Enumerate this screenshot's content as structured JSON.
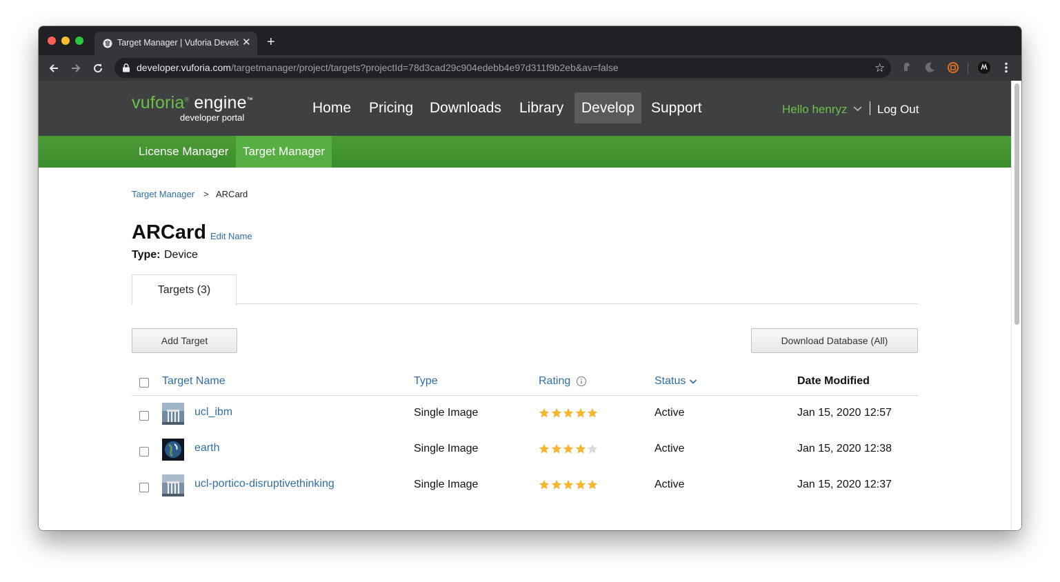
{
  "browser": {
    "tab_title": "Target Manager | Vuforia Develop",
    "tab_close": "✕",
    "new_tab": "+",
    "url_host": "developer.vuforia.com",
    "url_path": "/targetmanager/project/targets?projectId=78d3cad29c904edebb4e97d311f9b2eb&av=false",
    "bookmark_star": "☆"
  },
  "site": {
    "logo": {
      "word1": "vuforia",
      "reg": "®",
      "word2": " engine",
      "tm": "™",
      "subtitle": "developer portal"
    },
    "nav": [
      "Home",
      "Pricing",
      "Downloads",
      "Library",
      "Develop",
      "Support"
    ],
    "active_nav": "Develop",
    "user_greeting": "Hello henryz",
    "logout": "Log Out",
    "subnav": [
      "License Manager",
      "Target Manager"
    ],
    "active_subnav": "Target Manager"
  },
  "breadcrumb": {
    "root": "Target Manager",
    "separator": ">",
    "current": "ARCard"
  },
  "database": {
    "name": "ARCard",
    "edit_name": "Edit Name",
    "type_label": "Type:",
    "type_value": "Device"
  },
  "tabs": {
    "targets": "Targets (3)"
  },
  "actions": {
    "add_target": "Add Target",
    "download_database": "Download Database (All)"
  },
  "table": {
    "headers": {
      "target_name": "Target Name",
      "type": "Type",
      "rating": "Rating",
      "status": "Status",
      "date_modified": "Date Modified"
    },
    "rows": [
      {
        "name": "ucl_ibm",
        "type": "Single Image",
        "rating": 5,
        "status": "Active",
        "date": "Jan 15, 2020 12:57"
      },
      {
        "name": "earth",
        "type": "Single Image",
        "rating": 4,
        "status": "Active",
        "date": "Jan 15, 2020 12:38"
      },
      {
        "name": "ucl-portico-disruptivethinking",
        "type": "Single Image",
        "rating": 5,
        "status": "Active",
        "date": "Jan 15, 2020 12:37"
      }
    ]
  },
  "colors": {
    "accent_green": "#6cc04a",
    "link_blue": "#2f6ea7",
    "star_gold": "#f5b631",
    "star_empty": "#d9d9d9",
    "header_dark": "#3f4042"
  },
  "icons": {
    "traffic_lights": [
      "close-light",
      "minimize-light",
      "zoom-light"
    ],
    "toolbar": [
      "back-icon",
      "forward-icon",
      "reload-icon",
      "lock-icon",
      "bookmark-star-icon"
    ],
    "extensions": [
      "extension-icon",
      "dark-mode-icon",
      "extension-badge-icon",
      "profile-avatar-icon",
      "kebab-menu-icon"
    ],
    "table": [
      "info-icon",
      "chevron-down-icon",
      "star-icon"
    ]
  }
}
